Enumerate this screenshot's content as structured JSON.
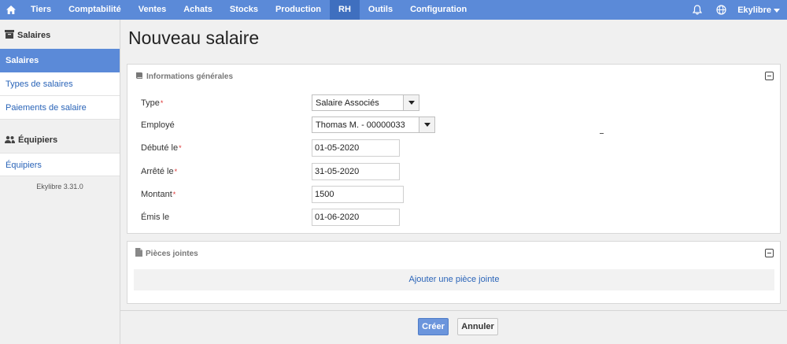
{
  "topbar": {
    "home_icon": "home-icon",
    "menu": [
      "Tiers",
      "Comptabilité",
      "Ventes",
      "Achats",
      "Stocks",
      "Production",
      "RH",
      "Outils",
      "Configuration"
    ],
    "active": "RH",
    "bell_icon": "bell-icon",
    "globe_icon": "globe-icon",
    "user": "Ekylibre"
  },
  "sidebar": {
    "group1": {
      "title": "Salaires",
      "icon": "archive-icon"
    },
    "items1": [
      "Salaires",
      "Types de salaires",
      "Paiements de salaire"
    ],
    "group2": {
      "title": "Équipiers",
      "icon": "users-icon"
    },
    "items2": [
      "Équipiers"
    ],
    "version": "Ekylibre 3.31.0"
  },
  "page": {
    "title": "Nouveau salaire"
  },
  "general": {
    "title": "Informations générales",
    "type_label": "Type",
    "type_value": "Salaire Associés",
    "employee_label": "Employé",
    "employee_value": "Thomas M. - 00000033",
    "start_label": "Débuté le",
    "start_value": "01-05-2020",
    "stop_label": "Arrêté le",
    "stop_value": "31-05-2020",
    "amount_label": "Montant",
    "amount_value": "1500",
    "emitted_label": "Émis le",
    "emitted_value": "01-06-2020",
    "required_mark": "*"
  },
  "attachments": {
    "title": "Pièces jointes",
    "add_label": "Ajouter une pièce jointe"
  },
  "actions": {
    "create": "Créer",
    "cancel": "Annuler"
  },
  "colors": {
    "topbar": "#5b8ad8",
    "link": "#2a64b8",
    "required": "#dd3333"
  }
}
